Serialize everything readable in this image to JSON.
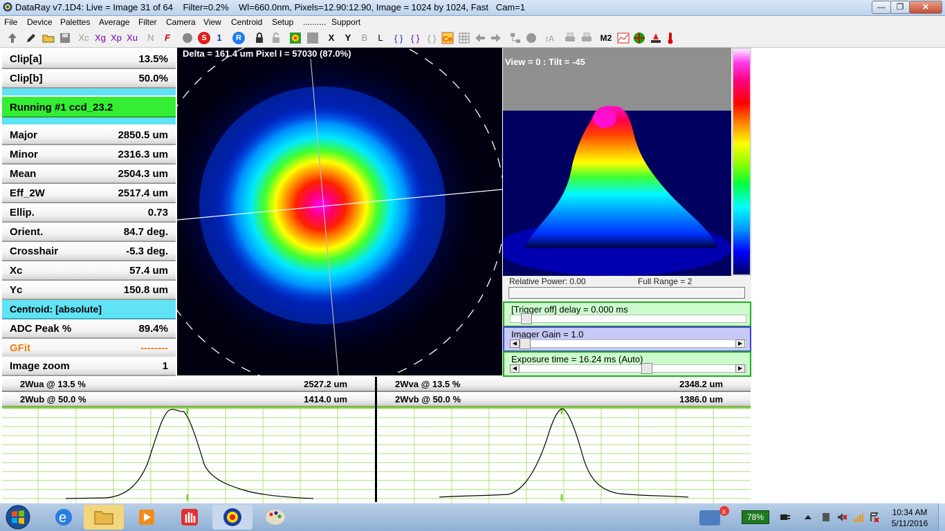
{
  "window": {
    "title": "DataRay v7.1D4: Live = Image 31 of 64    Filter=0.2%    Wl=660.0nm, Pixels=12.90:12.90, Image = 1024 by 1024, Fast   Cam=1",
    "min_glyph": "—",
    "max_glyph": "❐",
    "close_glyph": "✕"
  },
  "menu": [
    "File",
    "Device",
    "Palettes",
    "Average",
    "Filter",
    "Camera",
    "View",
    "Centroid",
    "Setup",
    "..........",
    "Support"
  ],
  "toolbar": {
    "buttons": [
      "Xc",
      "Xg",
      "Xp",
      "Xu",
      "N",
      "F",
      "S",
      "1",
      "R",
      "X",
      "Y",
      "B",
      "L",
      "M2"
    ]
  },
  "readouts": {
    "clip_a": {
      "label": "Clip[a]",
      "value": "13.5%"
    },
    "clip_b": {
      "label": "Clip[b]",
      "value": "50.0%"
    },
    "running": "Running #1 ccd_23.2",
    "major": {
      "label": "Major",
      "value": "2850.5 um"
    },
    "minor": {
      "label": "Minor",
      "value": "2316.3 um"
    },
    "mean": {
      "label": "Mean",
      "value": "2504.3 um"
    },
    "eff_2w": {
      "label": "Eff_2W",
      "value": "2517.4 um"
    },
    "ellip": {
      "label": "Ellip.",
      "value": "0.73"
    },
    "orient": {
      "label": "Orient.",
      "value": "84.7 deg."
    },
    "crosshair": {
      "label": "Crosshair",
      "value": "-5.3 deg."
    },
    "xc": {
      "label": "Xc",
      "value": "57.4 um"
    },
    "yc": {
      "label": "Yc",
      "value": "150.8 um"
    },
    "centroid": "Centroid: [absolute]",
    "adc_peak": {
      "label": "ADC Peak %",
      "value": "89.4%"
    },
    "gfit": {
      "label": "GFit",
      "value": "--------"
    },
    "image_zoom": {
      "label": "Image zoom",
      "value": "1"
    }
  },
  "beam_image": {
    "label": "Delta = 161.4 um Pixel I = 57030 (87.0%)"
  },
  "view3d": {
    "label": "View = 0 : Tilt = -45"
  },
  "power": {
    "relative": "Relative Power: 0.00",
    "full_range": "Full Range = 2",
    "level": 0.0
  },
  "controls": {
    "trigger": {
      "label": "[Trigger off] delay = 0.000 ms",
      "level": 0.0
    },
    "gain": {
      "label": "Imager Gain = 1.0",
      "level": 0.0
    },
    "exposure": {
      "label": "Exposure time = 16.24 ms (Auto)",
      "level": 0.55
    }
  },
  "profiles": {
    "left": {
      "wa": {
        "label": "2Wua @ 13.5 %",
        "value": "2527.2 um"
      },
      "wb": {
        "label": "2Wub @ 50.0 %",
        "value": "1414.0 um"
      }
    },
    "right": {
      "wa": {
        "label": "2Wva @ 13.5 %",
        "value": "2348.2 um"
      },
      "wb": {
        "label": "2Wvb @ 50.0 %",
        "value": "1386.0 um"
      }
    }
  },
  "taskbar": {
    "battery": "78%",
    "time": "10:34 AM",
    "date": "5/11/2016"
  },
  "colors": {
    "accent_green": "#33ee33",
    "accent_cyan": "#5fe3f5",
    "grid_green": "#7cd431",
    "gain_blue": "#c6c8f6"
  }
}
